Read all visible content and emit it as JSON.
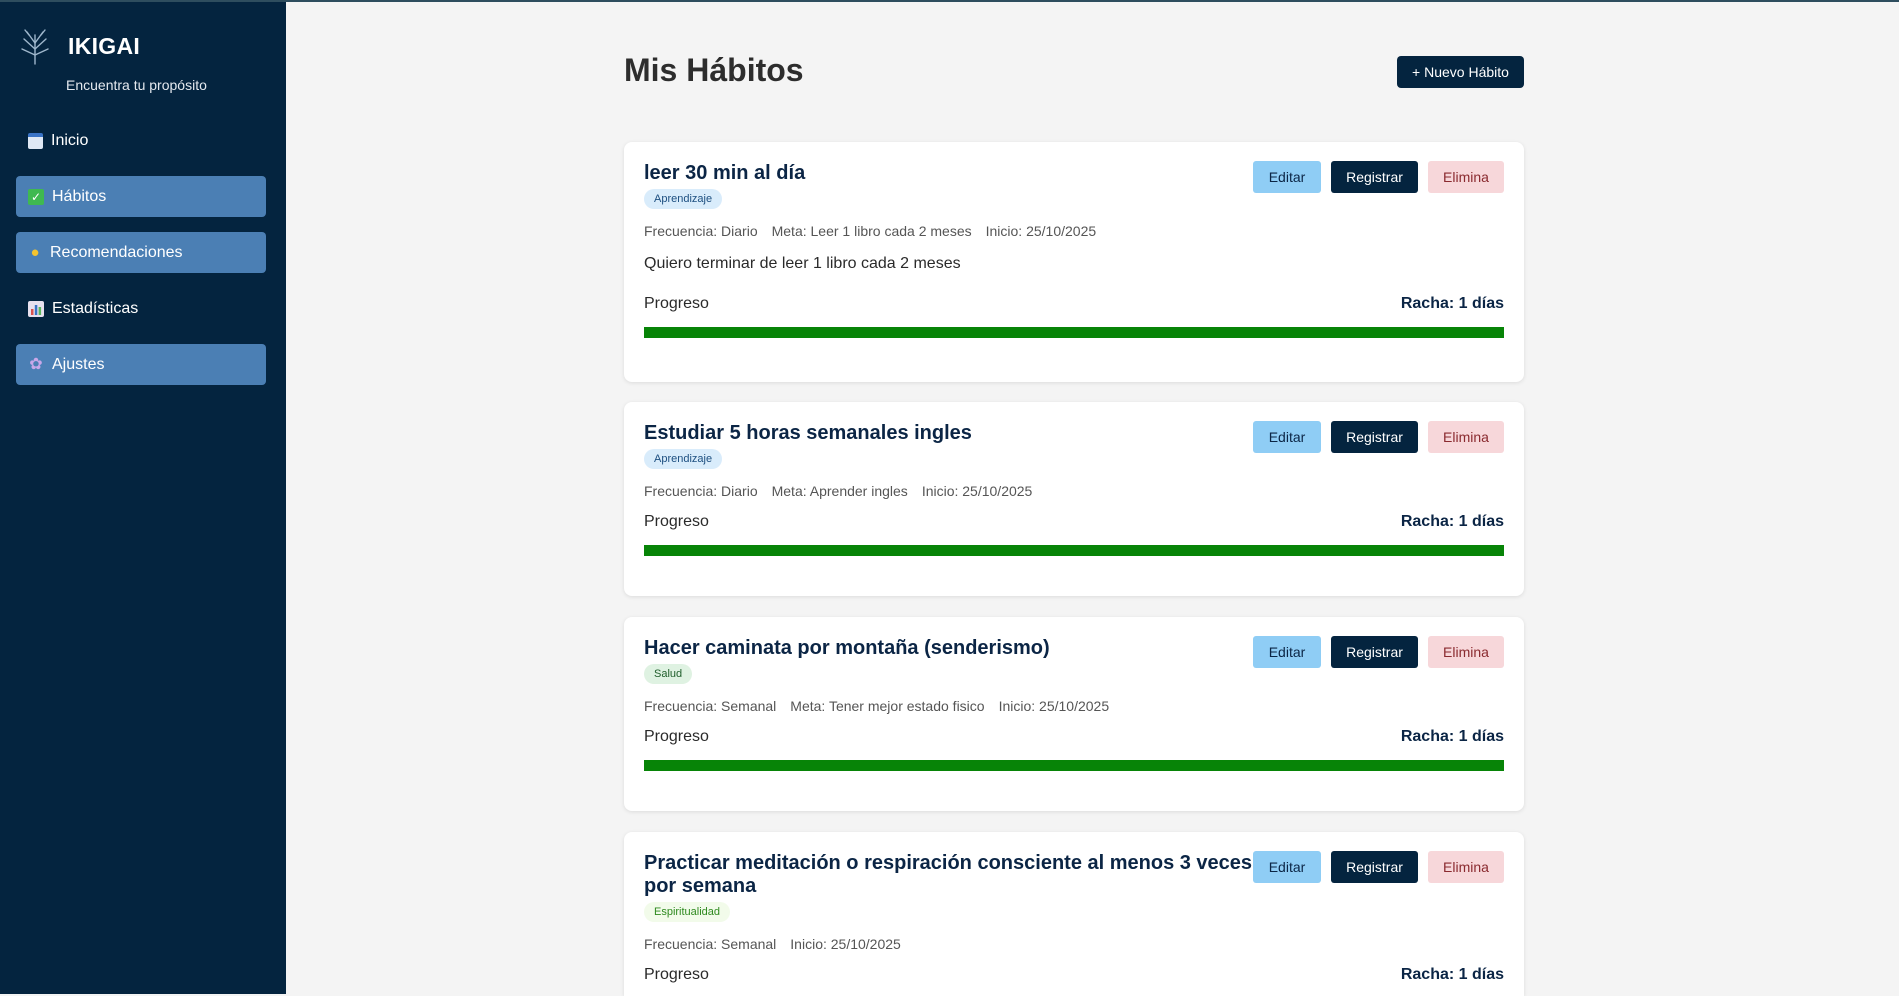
{
  "sidebar": {
    "brand_title": "IKIGAI",
    "brand_subtitle": "Encuentra tu propósito",
    "items": [
      {
        "label": "Inicio",
        "icon": "calendar-icon",
        "active": false
      },
      {
        "label": "Hábitos",
        "icon": "check-icon",
        "active": true
      },
      {
        "label": "Recomendaciones",
        "icon": "lightbulb-icon",
        "active": true
      },
      {
        "label": "Estadísticas",
        "icon": "chart-icon",
        "active": false
      },
      {
        "label": "Ajustes",
        "icon": "gear-icon",
        "active": true
      }
    ]
  },
  "header": {
    "title": "Mis Hábitos",
    "new_button": "+ Nuevo Hábito"
  },
  "actions": {
    "edit": "Editar",
    "register": "Registrar",
    "delete": "Elimina"
  },
  "progress_label": "Progreso",
  "habits": [
    {
      "title": "leer 30 min al día",
      "category": "Aprendizaje",
      "frequency": "Frecuencia: Diario",
      "goal": "Meta: Leer 1 libro cada 2 meses",
      "start": "Inicio: 25/10/2025",
      "description": "Quiero terminar de leer 1 libro cada 2 meses",
      "streak": "Racha: 1 días",
      "progress": 1.0
    },
    {
      "title": "Estudiar 5 horas semanales ingles",
      "category": "Aprendizaje",
      "frequency": "Frecuencia: Diario",
      "goal": "Meta: Aprender ingles",
      "start": "Inicio: 25/10/2025",
      "streak": "Racha: 1 días",
      "progress": 1.0
    },
    {
      "title": "Hacer caminata por montaña (senderismo)",
      "category": "Salud",
      "frequency": "Frecuencia: Semanal",
      "goal": "Meta: Tener mejor estado fisico",
      "start": "Inicio: 25/10/2025",
      "streak": "Racha: 1 días",
      "progress": 1.0
    },
    {
      "title": "Practicar meditación o respiración consciente al menos 3 veces por semana",
      "category": "Espiritualidad",
      "frequency": "Frecuencia: Semanal",
      "start": "Inicio: 25/10/2025",
      "streak": "Racha: 1 días",
      "progress": 1.0
    }
  ],
  "colors": {
    "sidebar_bg": "#04243f",
    "active_item": "#4b7fb4",
    "progress_fill": "#078407",
    "edit_button": "#8fcdf5",
    "delete_button": "#f7d7da"
  }
}
